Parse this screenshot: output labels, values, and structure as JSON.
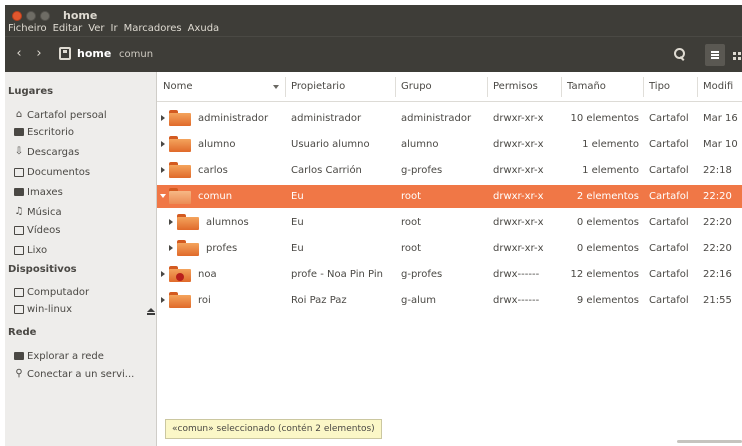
{
  "window": {
    "title": "home",
    "menu": [
      "Ficheiro",
      "Editar",
      "Ver",
      "Ir",
      "Marcadores",
      "Axuda"
    ]
  },
  "toolbar": {
    "back": "‹",
    "forward": "›",
    "breadcrumb": [
      "home",
      "comun"
    ]
  },
  "sidebar": {
    "sections": [
      {
        "heading": "Lugares",
        "items": [
          {
            "label": "Cartafol persoal",
            "icon": "home-icon"
          },
          {
            "label": "Escritorio",
            "icon": "desktop-icon"
          },
          {
            "label": "Descargas",
            "icon": "download-icon"
          },
          {
            "label": "Documentos",
            "icon": "document-icon"
          },
          {
            "label": "Imaxes",
            "icon": "camera-icon"
          },
          {
            "label": "Música",
            "icon": "music-icon"
          },
          {
            "label": "Vídeos",
            "icon": "film-icon"
          },
          {
            "label": "Lixo",
            "icon": "trash-icon"
          }
        ]
      },
      {
        "heading": "Dispositivos",
        "items": [
          {
            "label": "Computador",
            "icon": "computer-icon"
          },
          {
            "label": "win-linux",
            "icon": "drive-icon"
          }
        ]
      },
      {
        "heading": "Rede",
        "items": [
          {
            "label": "Explorar a rede",
            "icon": "network-icon"
          },
          {
            "label": "Conectar a un servi...",
            "icon": "server-icon"
          }
        ]
      }
    ]
  },
  "columns": [
    "Nome",
    "Propietario",
    "Grupo",
    "Permisos",
    "Tamaño",
    "Tipo",
    "Modifi"
  ],
  "rows": [
    {
      "name": "administrador",
      "owner": "administrador",
      "group": "administrador",
      "perms": "drwxr-xr-x",
      "size": "10 elementos",
      "type": "Cartafol",
      "modified": "Mar 16"
    },
    {
      "name": "alumno",
      "owner": "Usuario alumno",
      "group": "alumno",
      "perms": "drwxr-xr-x",
      "size": "1 elemento",
      "type": "Cartafol",
      "modified": "Mar 10"
    },
    {
      "name": "carlos",
      "owner": "Carlos Carrión",
      "group": "g-profes",
      "perms": "drwxr-xr-x",
      "size": "1 elemento",
      "type": "Cartafol",
      "modified": "22:18"
    },
    {
      "name": "comun",
      "owner": "Eu",
      "group": "root",
      "perms": "drwxr-xr-x",
      "size": "2 elementos",
      "type": "Cartafol",
      "modified": "22:20"
    },
    {
      "name": "alumnos",
      "owner": "Eu",
      "group": "root",
      "perms": "drwxr-xr-x",
      "size": "0 elementos",
      "type": "Cartafol",
      "modified": "22:20"
    },
    {
      "name": "profes",
      "owner": "Eu",
      "group": "root",
      "perms": "drwxr-xr-x",
      "size": "0 elementos",
      "type": "Cartafol",
      "modified": "22:20"
    },
    {
      "name": "noa",
      "owner": "profe - Noa Pin Pin",
      "group": "g-profes",
      "perms": "drwx------",
      "size": "12 elementos",
      "type": "Cartafol",
      "modified": "22:16"
    },
    {
      "name": "roi",
      "owner": "Roi Paz Paz",
      "group": "g-alum",
      "perms": "drwx------",
      "size": "9 elementos",
      "type": "Cartafol",
      "modified": "21:55"
    }
  ],
  "status": "«comun» seleccionado  (contén 2 elementos)",
  "colors": {
    "selection": "#f07746",
    "titlebar": "#3e3d38",
    "sidebar": "#eeedeb"
  }
}
